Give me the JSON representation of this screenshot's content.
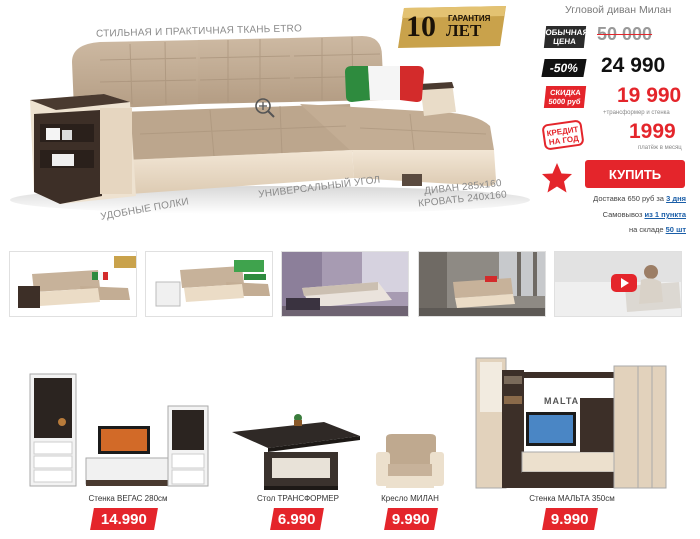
{
  "hero": {
    "feature_fabric": "СТИЛЬНАЯ И ПРАКТИЧНАЯ ТКАНЬ ETRO",
    "feature_shelves": "УДОБНЫЕ ПОЛКИ",
    "feature_corner": "УНИВЕРСАЛЬНЫЙ УГОЛ",
    "size_sofa": "ДИВАН 285x160",
    "size_bed": "КРОВАТЬ 240x160",
    "guarantee_number": "10",
    "guarantee_top": "ГАРАНТИЯ",
    "guarantee_bottom": "ЛЕТ"
  },
  "product": {
    "title": "Угловой диван Милан",
    "badge_regular": "ОБЫЧНАЯ ЦЕНА",
    "price_regular": "50 000",
    "badge_percent": "-50%",
    "price_discounted": "24 990",
    "badge_discount_line1": "СКИДКА",
    "badge_discount_line2": "5000 руб",
    "price_final": "19 990",
    "price_final_note": "+трансформер и стенка",
    "badge_credit": "КРЕДИТ НА ГОД",
    "price_credit": "1999",
    "price_credit_note": "платёж в месяц",
    "buy_label": "КУПИТЬ",
    "delivery_text": "Доставка 650 руб за",
    "delivery_link": "3 дня",
    "pickup_text": "Самовывоз",
    "pickup_link": "из 1 пункта",
    "stock_text": "на складе",
    "stock_link": "50 шт"
  },
  "products": [
    {
      "name": "Стенка ВЕГАС 280см",
      "price": "14.990"
    },
    {
      "name": "Стол ТРАНСФОРМЕР",
      "price": "6.990"
    },
    {
      "name": "Кресло МИЛАН",
      "price": "9.990"
    },
    {
      "name": "Стенка МАЛЬТА 350см",
      "price": "9.990"
    }
  ],
  "wall_sign": "MALTA",
  "colors": {
    "accent": "#e4252b",
    "sofa": "#c7b29a",
    "base": "#ebdcc6",
    "dark_wood": "#4a3a30",
    "link": "#1a5ea8"
  }
}
